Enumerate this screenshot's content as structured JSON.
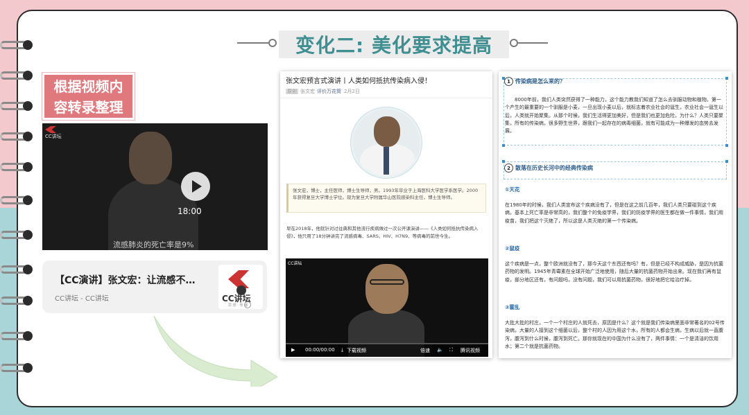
{
  "slide": {
    "title": "变化二: 美化要求提高",
    "badge": [
      "根据视频内",
      "容转录整理"
    ]
  },
  "video": {
    "logo_text": "CC讲坛",
    "time": "18:00",
    "subtitle": "流感肺炎的死亡率是9%"
  },
  "card": {
    "title": "【CC演讲】张文宏：让流感不…",
    "source": "CC讲坛 - CC讲坛",
    "logo_text": "CC讲坛",
    "logo_sub": "思 想 · 传 播"
  },
  "article": {
    "title": "张文宏预言式演讲丨人类如何抵抗传染病入侵！",
    "tag": "原创",
    "author": "张文宏",
    "account": "评价万花筒",
    "date": "2月2日",
    "bio": "张文宏，博士，主任医师，博士生导师，男。1993年毕业于上海医科大学医学系医学。2000年获得复旦大学博士学位。现为复旦大学附属华山医院感染科主任，博士生导师。",
    "intro": "早在2018年，他就针对过往典和其他流行疾病做过一次公开课演讲——《人类如何抵抗传染病入侵》，他只用了18分钟讲完了流感病毒、SARS、HIV、H7N9、等病毒的前世今生。",
    "video": {
      "logo": "CC讲坛",
      "time": "00:00/00:00",
      "download": "下载视频",
      "speed": "倍速",
      "brand": "腾讯视频"
    }
  },
  "transcript": {
    "sections": [
      {
        "num": "1",
        "title": "传染病是怎么来的？",
        "body": "8000年前，我们人类突然获得了一种能力，这个能力教我们知道了怎么去驯服动物和植物。第一个产生的最重要的一个驯服是小麦，一旦出现小麦以后，就标志着农业社会的诞生，农业社会一诞生以后，人类就开始聚集。从那个时候，我们生活得更加美好，但是我们也更加危险，为什么？人类只要聚集，所有的传染病，很多野生世界，跟我们一起存在的病毒细菌，就有可能成为一种爆发的态势去发展。"
      },
      {
        "num": "2",
        "title": "散落在历史长河中的经典传染病"
      }
    ],
    "items": [
      {
        "title": "①天花",
        "body": "在1980年的时候，我们人类宣布这个疾病没有了，但是在这之前几百年，我们人类只要碰到这个疾病，基本上死亡率是非常高的，我们整个的免疫学界，我们的防疫学界的医生都在做一件事情，我们用疫苗，我们把这个灭绝了，所以这是人类灭绝的第一个传染病。"
      },
      {
        "title": "②鼠疫",
        "body": "这个疾病是一点，整个欧洲就没有了，那今天这个东西还有吗？有，但是已经不构成威胁，是因为抗菌药物的发明。1945年青霉素在全球开始广泛地使用，随后大量的抗菌药物开始出来。现在我们再有鼠疫，部分地区还有，有问题吗，没有问题，我们可以用抗菌药物，很好地把它给治疗掉。"
      },
      {
        "title": "③霍乱",
        "body": "大批大批的村庄，一个一个村庄的人就死去，原因是什么？这个就是我们传染病里面非常著名的02号传染病，大量的人接到这个细菌以后，整个村的人因为用这个水，所有的人都会生病，生病以后就一直腹泻，腹泻到什么时候，腹泻到死亡。那你就现在的中国为什么没有了，两件事情：一个是清洁的饮用水；第二个就是抗菌药物。"
      }
    ]
  }
}
